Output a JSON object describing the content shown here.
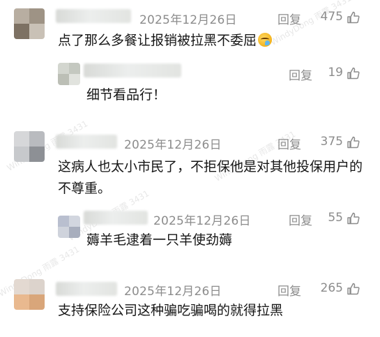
{
  "comments": [
    {
      "date": "2025年12月26日",
      "reply_label": "回复",
      "likes": "475",
      "text": "点了那么多餐让报销被拉黑不委屈",
      "has_emoji": true,
      "emoji_name": "crying-laughing-emoji",
      "replies": [
        {
          "date": "",
          "reply_label": "回复",
          "likes": "19",
          "text": "细节看品行！"
        }
      ]
    },
    {
      "date": "2025年12月26日",
      "reply_label": "回复",
      "likes": "375",
      "text": "这病人也太小市民了，不拒保他是对其他投保用户的不尊重。",
      "replies": [
        {
          "date": "2025年12月26日",
          "reply_label": "回复",
          "likes": "55",
          "text": "薅羊毛逮着一只羊使劲薅"
        }
      ]
    },
    {
      "date": "2025年12月26日",
      "reply_label": "回复",
      "likes": "265",
      "text": "支持保险公司这种骗吃骗喝的就得拉黑"
    }
  ],
  "watermarks": [
    "WindyDong 雨露 3431",
    "WindyDong 雨露 3431",
    "WindyDong 雨露 3431",
    "WindyDong 雨露 3431",
    "WindyDong 雨露 3431"
  ],
  "icons": {
    "like": "thumbs-up-icon"
  },
  "colors": {
    "meta": "#8c8c8c",
    "text": "#151515"
  }
}
